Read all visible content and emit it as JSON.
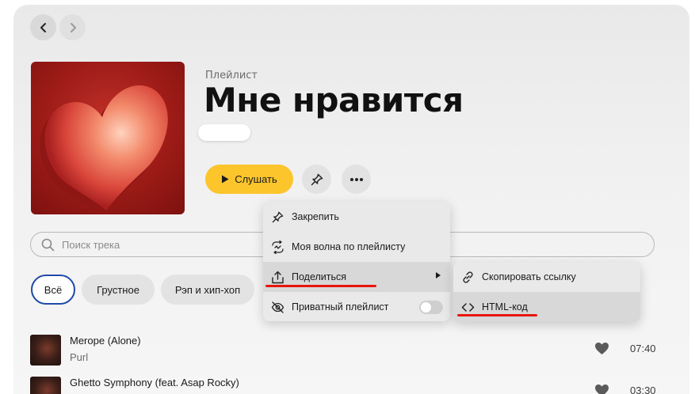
{
  "playlist": {
    "kind_label": "Плейлист",
    "title": "Мне нравится",
    "play_label": "Слушать"
  },
  "search": {
    "placeholder": "Поиск трека"
  },
  "filters": [
    "Всё",
    "Грустное",
    "Рэп и хип-хоп"
  ],
  "tracks": [
    {
      "name": "Merope (Alone)",
      "artist": "Purl",
      "duration": "07:40"
    },
    {
      "name": "Ghetto Symphony (feat. Asap Rocky)",
      "artist": "",
      "duration": "03:30"
    }
  ],
  "context_menu": {
    "items": [
      {
        "label": "Закрепить",
        "icon": "pin-icon"
      },
      {
        "label": "Моя волна по плейлисту",
        "icon": "wave-icon"
      },
      {
        "label": "Поделиться",
        "icon": "share-icon",
        "has_submenu": true,
        "highlighted": true
      },
      {
        "label": "Приватный плейлист",
        "icon": "eye-off-icon",
        "toggle": false
      }
    ]
  },
  "share_submenu": {
    "items": [
      {
        "label": "Скопировать ссылку",
        "icon": "link-icon"
      },
      {
        "label": "HTML-код",
        "icon": "code-icon",
        "highlighted": true
      }
    ]
  },
  "colors": {
    "accent_yellow": "#fcc52c",
    "annotation_red": "#e8150c",
    "chip_active_border": "#1f4aa8"
  }
}
